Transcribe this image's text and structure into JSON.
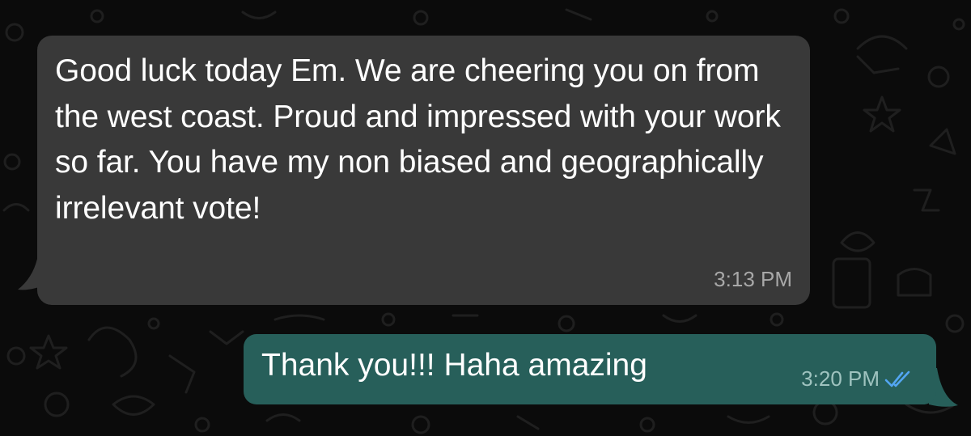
{
  "chat": {
    "messages": [
      {
        "direction": "incoming",
        "text": "Good luck today Em. We are cheering you on from the west coast. Proud and impressed with your work so far. You have my non biased and geographically irrelevant vote!",
        "time": "3:13 PM"
      },
      {
        "direction": "outgoing",
        "text": "Thank you!!! Haha amazing",
        "time": "3:20 PM",
        "status_icon": "double-check-read-icon"
      }
    ]
  },
  "colors": {
    "background": "#0b0b0b",
    "incoming_bubble": "#393939",
    "outgoing_bubble": "#275f5a",
    "read_check": "#53a6f2",
    "timestamp_incoming": "#a8a8a8",
    "timestamp_outgoing": "#9fc3bf"
  }
}
